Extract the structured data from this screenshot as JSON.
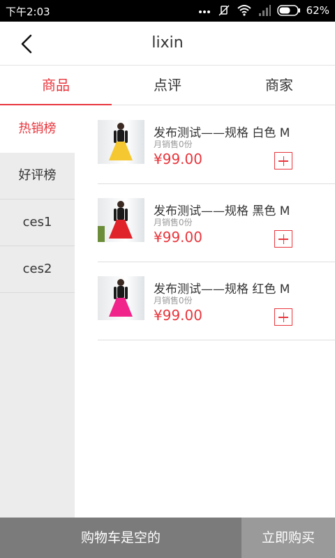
{
  "status_bar": {
    "time": "下午2:03",
    "battery": "62%"
  },
  "nav": {
    "title": "lixin"
  },
  "tabs": [
    {
      "label": "商品",
      "active": true
    },
    {
      "label": "点评",
      "active": false
    },
    {
      "label": "商家",
      "active": false
    }
  ],
  "sidebar": {
    "items": [
      {
        "label": "热销榜",
        "active": true
      },
      {
        "label": "好评榜",
        "active": false
      },
      {
        "label": "ces1",
        "active": false
      },
      {
        "label": "ces2",
        "active": false
      }
    ]
  },
  "products": [
    {
      "title": "发布测试——规格 白色 M",
      "sales": "月销售0份",
      "price": "¥99.00",
      "skirt_color": "#f5c730"
    },
    {
      "title": "发布测试——规格 黑色 M",
      "sales": "月销售0份",
      "price": "¥99.00",
      "skirt_color": "#e0232b"
    },
    {
      "title": "发布测试——规格 红色 M",
      "sales": "月销售0份",
      "price": "¥99.00",
      "skirt_color": "#f0248a"
    }
  ],
  "bottom_bar": {
    "cart_status": "购物车是空的",
    "buy_now": "立即购买"
  },
  "colors": {
    "accent": "#e8353c",
    "cart_bar": "#7b7b7b",
    "buy_bar": "#9a9a9a"
  }
}
